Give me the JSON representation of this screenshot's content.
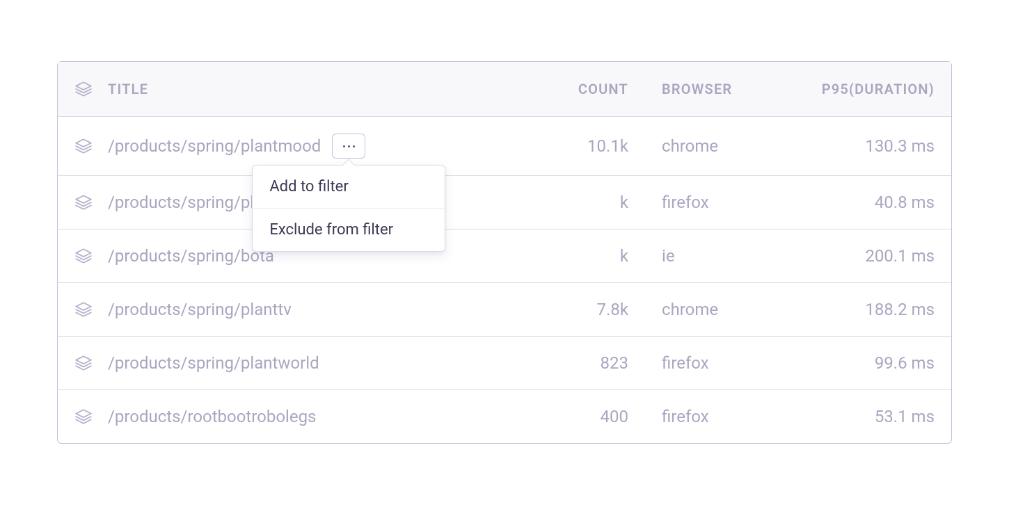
{
  "columns": {
    "title": "TITLE",
    "count": "COUNT",
    "browser": "BROWSER",
    "p95": "P95(DURATION)"
  },
  "rows": [
    {
      "title": "/products/spring/plantmood",
      "count": "10.1k",
      "browser": "chrome",
      "p95": "130.3 ms",
      "has_menu": true
    },
    {
      "title": "/products/spring/plant",
      "count": "k",
      "browser": "firefox",
      "p95": "40.8 ms",
      "has_menu": false
    },
    {
      "title": "/products/spring/bota",
      "count": "k",
      "browser": "ie",
      "p95": "200.1 ms",
      "has_menu": false
    },
    {
      "title": "/products/spring/planttv",
      "count": "7.8k",
      "browser": "chrome",
      "p95": "188.2 ms",
      "has_menu": false
    },
    {
      "title": "/products/spring/plantworld",
      "count": "823",
      "browser": "firefox",
      "p95": "99.6 ms",
      "has_menu": false
    },
    {
      "title": "/products/rootbootrobolegs",
      "count": "400",
      "browser": "firefox",
      "p95": "53.1 ms",
      "has_menu": false
    }
  ],
  "popover": {
    "add": "Add to filter",
    "exclude": "Exclude from filter"
  }
}
